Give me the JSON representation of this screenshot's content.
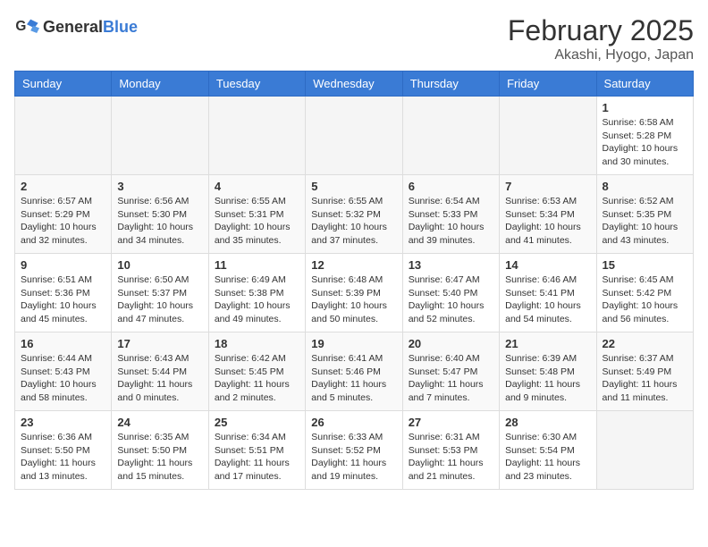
{
  "header": {
    "logo": {
      "text_general": "General",
      "text_blue": "Blue"
    },
    "month": "February 2025",
    "location": "Akashi, Hyogo, Japan"
  },
  "weekdays": [
    "Sunday",
    "Monday",
    "Tuesday",
    "Wednesday",
    "Thursday",
    "Friday",
    "Saturday"
  ],
  "weeks": [
    [
      {
        "day": "",
        "info": ""
      },
      {
        "day": "",
        "info": ""
      },
      {
        "day": "",
        "info": ""
      },
      {
        "day": "",
        "info": ""
      },
      {
        "day": "",
        "info": ""
      },
      {
        "day": "",
        "info": ""
      },
      {
        "day": "1",
        "info": "Sunrise: 6:58 AM\nSunset: 5:28 PM\nDaylight: 10 hours\nand 30 minutes."
      }
    ],
    [
      {
        "day": "2",
        "info": "Sunrise: 6:57 AM\nSunset: 5:29 PM\nDaylight: 10 hours\nand 32 minutes."
      },
      {
        "day": "3",
        "info": "Sunrise: 6:56 AM\nSunset: 5:30 PM\nDaylight: 10 hours\nand 34 minutes."
      },
      {
        "day": "4",
        "info": "Sunrise: 6:55 AM\nSunset: 5:31 PM\nDaylight: 10 hours\nand 35 minutes."
      },
      {
        "day": "5",
        "info": "Sunrise: 6:55 AM\nSunset: 5:32 PM\nDaylight: 10 hours\nand 37 minutes."
      },
      {
        "day": "6",
        "info": "Sunrise: 6:54 AM\nSunset: 5:33 PM\nDaylight: 10 hours\nand 39 minutes."
      },
      {
        "day": "7",
        "info": "Sunrise: 6:53 AM\nSunset: 5:34 PM\nDaylight: 10 hours\nand 41 minutes."
      },
      {
        "day": "8",
        "info": "Sunrise: 6:52 AM\nSunset: 5:35 PM\nDaylight: 10 hours\nand 43 minutes."
      }
    ],
    [
      {
        "day": "9",
        "info": "Sunrise: 6:51 AM\nSunset: 5:36 PM\nDaylight: 10 hours\nand 45 minutes."
      },
      {
        "day": "10",
        "info": "Sunrise: 6:50 AM\nSunset: 5:37 PM\nDaylight: 10 hours\nand 47 minutes."
      },
      {
        "day": "11",
        "info": "Sunrise: 6:49 AM\nSunset: 5:38 PM\nDaylight: 10 hours\nand 49 minutes."
      },
      {
        "day": "12",
        "info": "Sunrise: 6:48 AM\nSunset: 5:39 PM\nDaylight: 10 hours\nand 50 minutes."
      },
      {
        "day": "13",
        "info": "Sunrise: 6:47 AM\nSunset: 5:40 PM\nDaylight: 10 hours\nand 52 minutes."
      },
      {
        "day": "14",
        "info": "Sunrise: 6:46 AM\nSunset: 5:41 PM\nDaylight: 10 hours\nand 54 minutes."
      },
      {
        "day": "15",
        "info": "Sunrise: 6:45 AM\nSunset: 5:42 PM\nDaylight: 10 hours\nand 56 minutes."
      }
    ],
    [
      {
        "day": "16",
        "info": "Sunrise: 6:44 AM\nSunset: 5:43 PM\nDaylight: 10 hours\nand 58 minutes."
      },
      {
        "day": "17",
        "info": "Sunrise: 6:43 AM\nSunset: 5:44 PM\nDaylight: 11 hours\nand 0 minutes."
      },
      {
        "day": "18",
        "info": "Sunrise: 6:42 AM\nSunset: 5:45 PM\nDaylight: 11 hours\nand 2 minutes."
      },
      {
        "day": "19",
        "info": "Sunrise: 6:41 AM\nSunset: 5:46 PM\nDaylight: 11 hours\nand 5 minutes."
      },
      {
        "day": "20",
        "info": "Sunrise: 6:40 AM\nSunset: 5:47 PM\nDaylight: 11 hours\nand 7 minutes."
      },
      {
        "day": "21",
        "info": "Sunrise: 6:39 AM\nSunset: 5:48 PM\nDaylight: 11 hours\nand 9 minutes."
      },
      {
        "day": "22",
        "info": "Sunrise: 6:37 AM\nSunset: 5:49 PM\nDaylight: 11 hours\nand 11 minutes."
      }
    ],
    [
      {
        "day": "23",
        "info": "Sunrise: 6:36 AM\nSunset: 5:50 PM\nDaylight: 11 hours\nand 13 minutes."
      },
      {
        "day": "24",
        "info": "Sunrise: 6:35 AM\nSunset: 5:50 PM\nDaylight: 11 hours\nand 15 minutes."
      },
      {
        "day": "25",
        "info": "Sunrise: 6:34 AM\nSunset: 5:51 PM\nDaylight: 11 hours\nand 17 minutes."
      },
      {
        "day": "26",
        "info": "Sunrise: 6:33 AM\nSunset: 5:52 PM\nDaylight: 11 hours\nand 19 minutes."
      },
      {
        "day": "27",
        "info": "Sunrise: 6:31 AM\nSunset: 5:53 PM\nDaylight: 11 hours\nand 21 minutes."
      },
      {
        "day": "28",
        "info": "Sunrise: 6:30 AM\nSunset: 5:54 PM\nDaylight: 11 hours\nand 23 minutes."
      },
      {
        "day": "",
        "info": ""
      }
    ]
  ]
}
